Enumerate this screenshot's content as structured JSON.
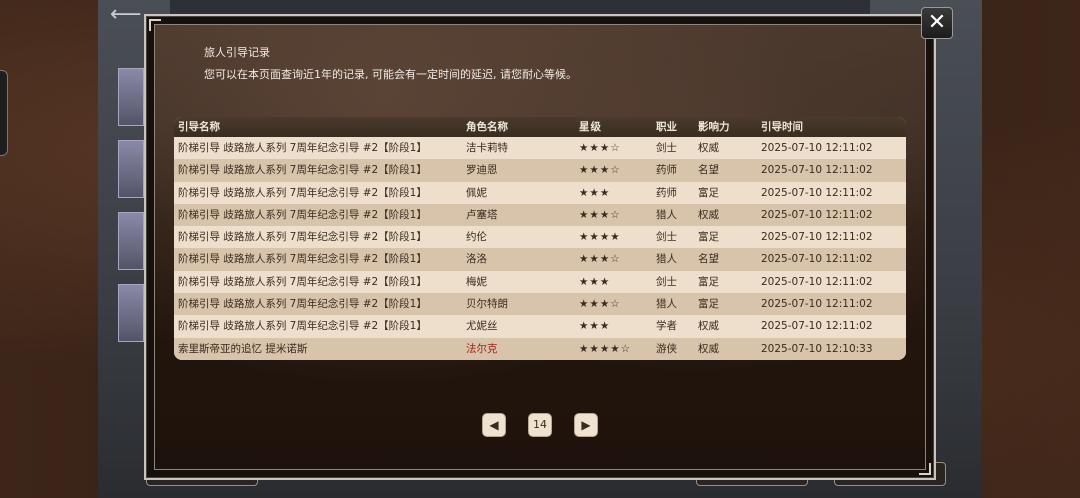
{
  "dialog": {
    "title": "旅人引导记录",
    "description": "您可以在本页面查询近1年的记录, 可能会有一定时间的延迟, 请您耐心等候。",
    "close_label": "✕"
  },
  "table": {
    "headers": [
      "引导名称",
      "角色名称",
      "星级",
      "职业",
      "影响力",
      "引导时间"
    ],
    "rows": [
      {
        "name": "阶梯引导 歧路旅人系列 7周年纪念引导 #2【阶段1】",
        "role": "洁卡莉特",
        "stars": "★★★☆",
        "job": "剑士",
        "influence": "权威",
        "time": "2025-07-10 12:11:02"
      },
      {
        "name": "阶梯引导 歧路旅人系列 7周年纪念引导 #2【阶段1】",
        "role": "罗迪恩",
        "stars": "★★★☆",
        "job": "药师",
        "influence": "名望",
        "time": "2025-07-10 12:11:02"
      },
      {
        "name": "阶梯引导 歧路旅人系列 7周年纪念引导 #2【阶段1】",
        "role": "佩妮",
        "stars": "★★★",
        "job": "药师",
        "influence": "富足",
        "time": "2025-07-10 12:11:02"
      },
      {
        "name": "阶梯引导 歧路旅人系列 7周年纪念引导 #2【阶段1】",
        "role": "卢塞塔",
        "stars": "★★★☆",
        "job": "猎人",
        "influence": "权威",
        "time": "2025-07-10 12:11:02"
      },
      {
        "name": "阶梯引导 歧路旅人系列 7周年纪念引导 #2【阶段1】",
        "role": "约伦",
        "stars": "★★★★",
        "job": "剑士",
        "influence": "富足",
        "time": "2025-07-10 12:11:02"
      },
      {
        "name": "阶梯引导 歧路旅人系列 7周年纪念引导 #2【阶段1】",
        "role": "洛洛",
        "stars": "★★★☆",
        "job": "猎人",
        "influence": "名望",
        "time": "2025-07-10 12:11:02"
      },
      {
        "name": "阶梯引导 歧路旅人系列 7周年纪念引导 #2【阶段1】",
        "role": "梅妮",
        "stars": "★★★",
        "job": "剑士",
        "influence": "富足",
        "time": "2025-07-10 12:11:02"
      },
      {
        "name": "阶梯引导 歧路旅人系列 7周年纪念引导 #2【阶段1】",
        "role": "贝尔特朗",
        "stars": "★★★☆",
        "job": "猎人",
        "influence": "富足",
        "time": "2025-07-10 12:11:02"
      },
      {
        "name": "阶梯引导 歧路旅人系列 7周年纪念引导 #2【阶段1】",
        "role": "尤妮丝",
        "stars": "★★★",
        "job": "学者",
        "influence": "权威",
        "time": "2025-07-10 12:11:02"
      },
      {
        "name": "索里斯帝亚的追忆 提米诺斯",
        "role": "法尔克",
        "stars": "★★★★☆",
        "job": "游侠",
        "influence": "权威",
        "time": "2025-07-10 12:10:33",
        "highlight": true
      }
    ]
  },
  "pager": {
    "prev_icon": "◀",
    "next_icon": "▶",
    "current_page": "14"
  },
  "colors": {
    "header_bg": "#3f3024",
    "row_light": "#eddfcc",
    "row_dark": "#d8c4ab",
    "highlight_text": "#a0201a"
  }
}
